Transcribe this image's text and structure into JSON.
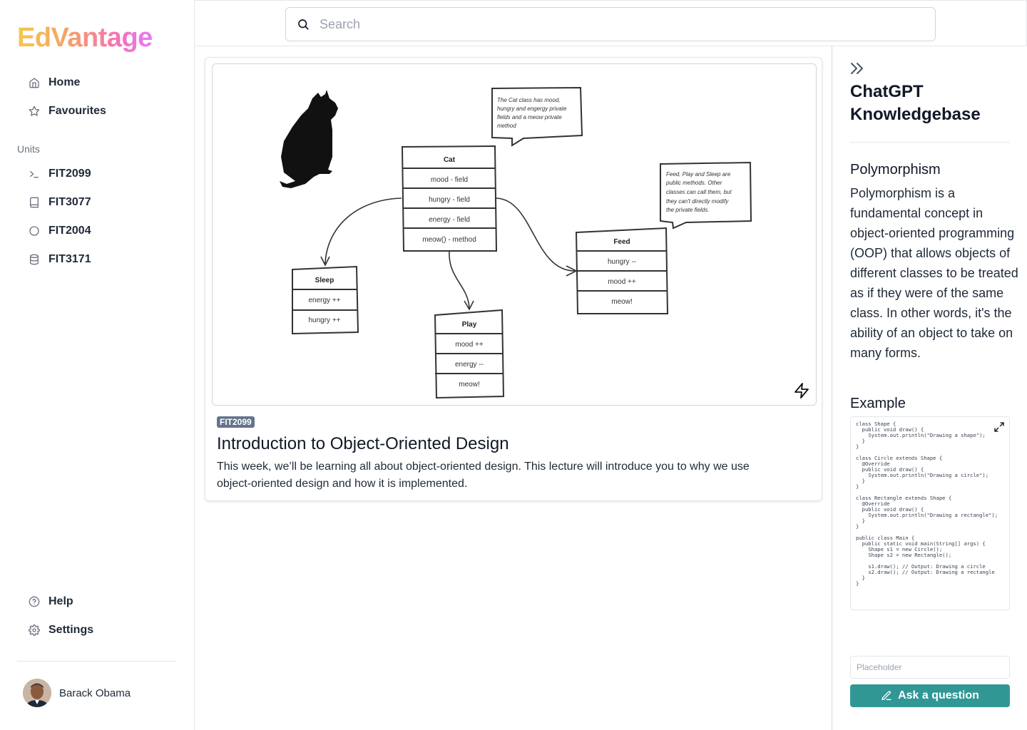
{
  "app": {
    "logo": "EdVantage"
  },
  "search": {
    "placeholder": "Search"
  },
  "sidebar": {
    "nav": [
      {
        "label": "Home",
        "icon": "home-icon"
      },
      {
        "label": "Favourites",
        "icon": "star-icon"
      }
    ],
    "units_label": "Units",
    "units": [
      {
        "label": "FIT2099",
        "icon": "terminal-icon"
      },
      {
        "label": "FIT3077",
        "icon": "book-icon"
      },
      {
        "label": "FIT2004",
        "icon": "circle-icon"
      },
      {
        "label": "FIT3171",
        "icon": "database-icon"
      }
    ],
    "bottom": [
      {
        "label": "Help",
        "icon": "help-circle-icon"
      },
      {
        "label": "Settings",
        "icon": "gear-icon"
      }
    ],
    "user": {
      "name": "Barack Obama"
    }
  },
  "lecture": {
    "tag": "FIT2099",
    "title": "Introduction to Object-Oriented Design",
    "description": "This week, we’ll be learning all about object-oriented design. This lecture will introduce you to why we use object-oriented design and how it is implemented.",
    "diagram": {
      "cat_note": [
        "The Cat class has mood,",
        "hungry and engergy private",
        "fields and a meow private",
        "method"
      ],
      "methods_note": [
        "Feed, Play and Sleep are",
        "public methods. Other",
        "classes can call them, but",
        "they can't directly modify",
        "the private fields."
      ],
      "cat": {
        "name": "Cat",
        "rows": [
          "mood - field",
          "hungry - field",
          "energy - field",
          "meow() - method"
        ]
      },
      "sleep": {
        "name": "Sleep",
        "rows": [
          "energy ++",
          "hungry ++"
        ]
      },
      "play": {
        "name": "Play",
        "rows": [
          "mood ++",
          "energy --",
          "meow!"
        ]
      },
      "feed": {
        "name": "Feed",
        "rows": [
          "hungry --",
          "mood ++",
          "meow!"
        ]
      }
    }
  },
  "panel": {
    "title": "ChatGPT Knowledgebase",
    "topic": "Polymorphism",
    "topic_text": "Polymorphism is a fundamental concept in object-oriented programming (OOP) that allows objects of different classes to be treated as if they were of the same class. In other words, it's the ability of an object to take on many forms.",
    "example_heading": "Example",
    "code": "class Shape {\n  public void draw() {\n    System.out.println(\"Drawing a shape\");\n  }\n}\n\nclass Circle extends Shape {\n  @Override\n  public void draw() {\n    System.out.println(\"Drawing a circle\");\n  }\n}\n\nclass Rectangle extends Shape {\n  @Override\n  public void draw() {\n    System.out.println(\"Drawing a rectangle\");\n  }\n}\n\npublic class Main {\n  public static void main(String[] args) {\n    Shape s1 = new Circle();\n    Shape s2 = new Rectangle();\n\n    s1.draw(); // Output: Drawing a circle\n    s2.draw(); // Output: Drawing a rectangle\n  }\n}",
    "ask_placeholder": "Placeholder",
    "ask_button": "Ask a question"
  },
  "colors": {
    "accent": "#319795",
    "tag": "#64748b"
  }
}
